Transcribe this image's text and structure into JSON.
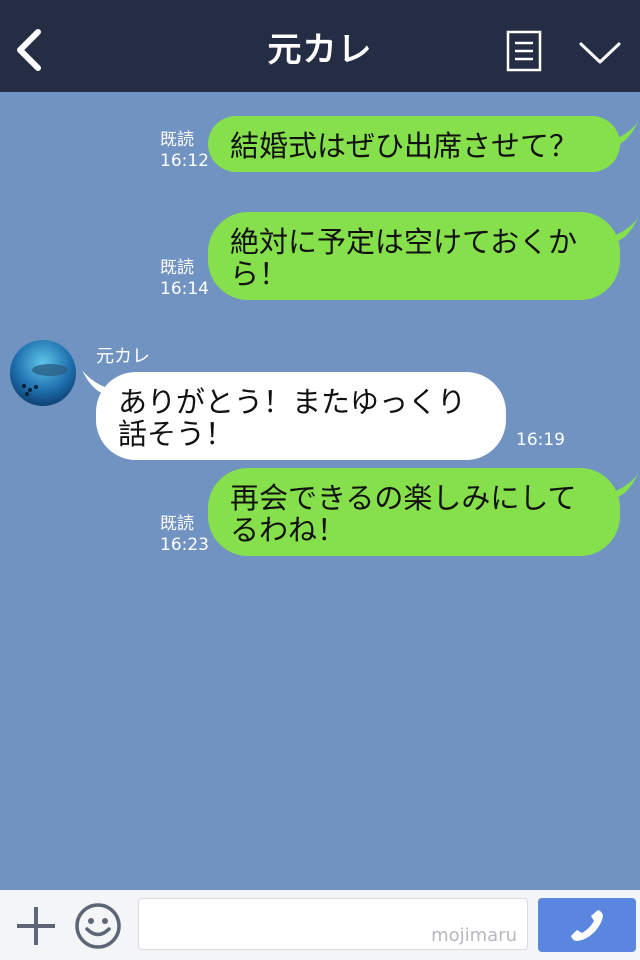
{
  "header": {
    "title": "元カレ"
  },
  "messages": [
    {
      "from": "me",
      "text": "結婚式はぜひ出席させて？",
      "read_label": "既読",
      "time": "16:12"
    },
    {
      "from": "me",
      "text": "絶対に予定は空けておくから！",
      "read_label": "既読",
      "time": "16:14"
    },
    {
      "from": "them",
      "sender": "元カレ",
      "text": "ありがとう！またゆっくり話そう！",
      "time": "16:19"
    },
    {
      "from": "me",
      "text": "再会できるの楽しみにしてるわね！",
      "read_label": "既読",
      "time": "16:23"
    }
  ],
  "input": {
    "watermark": "mojimaru"
  },
  "colors": {
    "header_bg": "#252d45",
    "chat_bg": "#7093c1",
    "my_bubble": "#85e04b",
    "their_bubble": "#ffffff",
    "call_button": "#5a86e0"
  },
  "icons": [
    "back-arrow-icon",
    "menu-list-icon",
    "chevron-down-icon",
    "plus-icon",
    "smile-icon",
    "phone-icon"
  ]
}
